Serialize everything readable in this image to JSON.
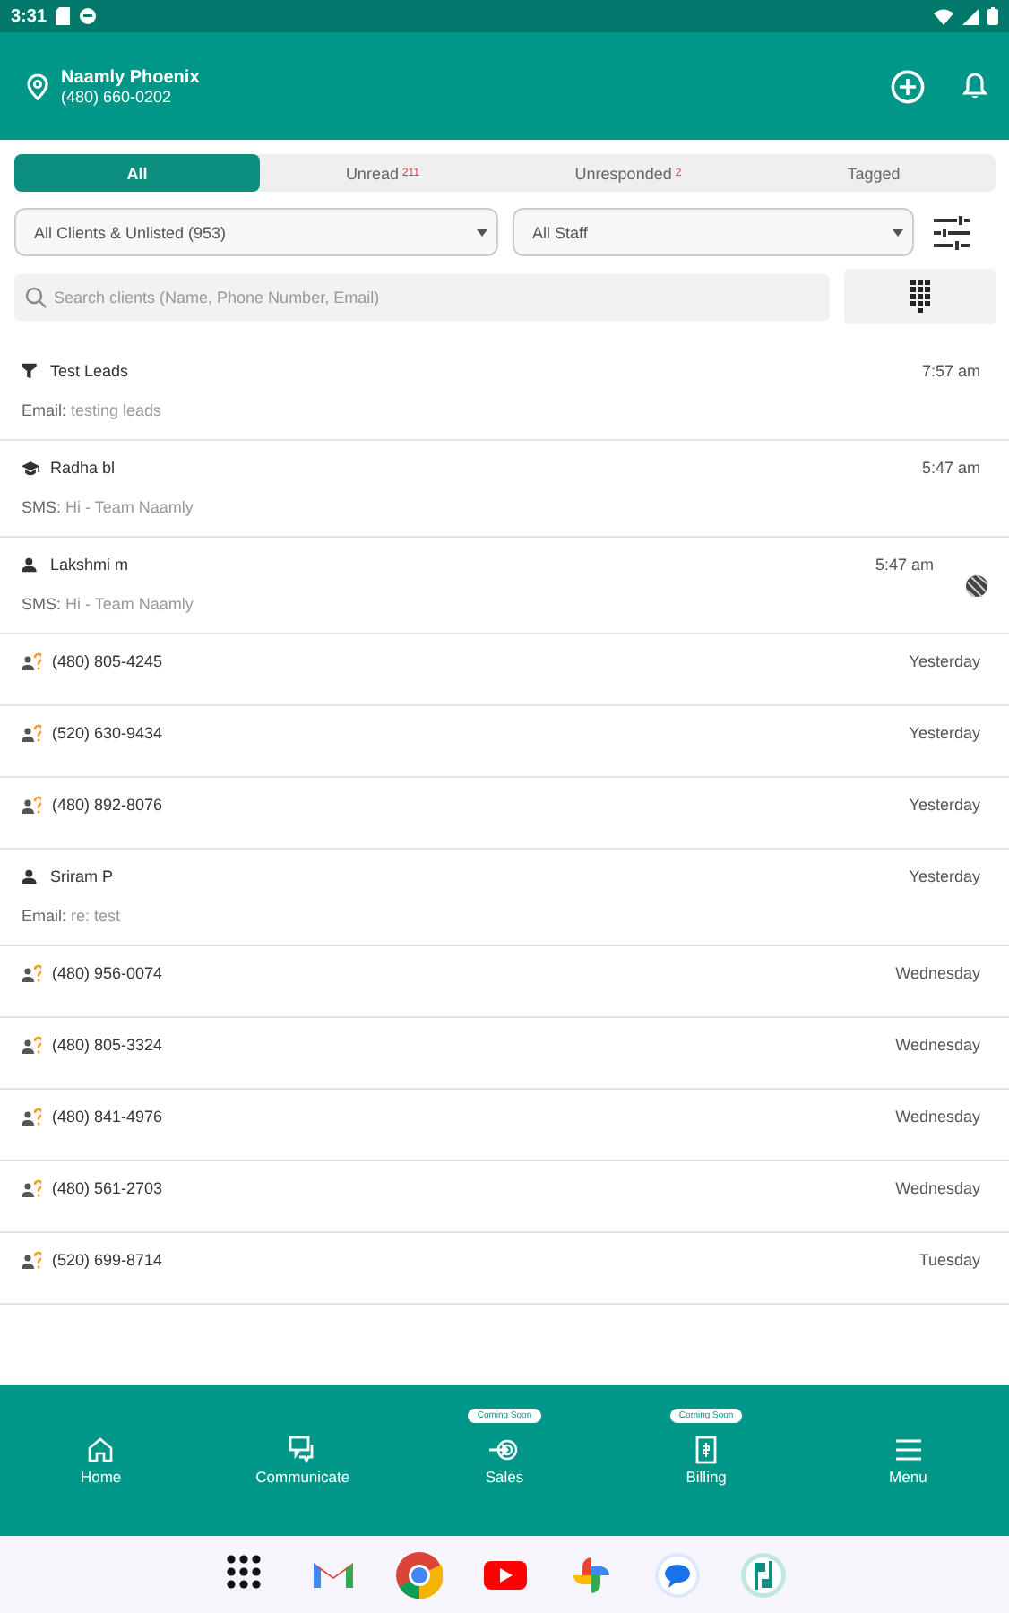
{
  "status_bar": {
    "time": "3:31"
  },
  "header": {
    "location_name": "Naamly Phoenix",
    "phone": "(480) 660-0202"
  },
  "tabs": [
    {
      "label": "All",
      "selected": true
    },
    {
      "label": "Unread",
      "count": "211",
      "selected": false
    },
    {
      "label": "Unresponded",
      "count": "2",
      "selected": false
    },
    {
      "label": "Tagged",
      "selected": false
    }
  ],
  "filters": [
    {
      "value": "All Clients & Unlisted (953)"
    },
    {
      "value": "All Staff"
    }
  ],
  "search": {
    "placeholder": "Search clients (Name, Phone Number, Email)"
  },
  "conversations": [
    {
      "kind": "lead",
      "name": "Test Leads",
      "time": "7:57 am",
      "channel": "Email:",
      "preview": "testing leads"
    },
    {
      "kind": "student",
      "name": "Radha bl",
      "time": "5:47 am",
      "channel": "SMS:",
      "preview": "Hi - Team Naamly"
    },
    {
      "kind": "client",
      "name": "Lakshmi m",
      "time": "5:47 am",
      "channel": "SMS:",
      "preview": "Hi - Team Naamly",
      "floating_icon": true
    },
    {
      "kind": "unknown",
      "name": "(480) 805-4245",
      "time": "Yesterday"
    },
    {
      "kind": "unknown",
      "name": "(520) 630-9434",
      "time": "Yesterday"
    },
    {
      "kind": "unknown",
      "name": "(480) 892-8076",
      "time": "Yesterday"
    },
    {
      "kind": "client",
      "name": "Sriram P",
      "time": "Yesterday",
      "channel": "Email:",
      "preview": "re: test"
    },
    {
      "kind": "unknown",
      "name": "(480) 956-0074",
      "time": "Wednesday"
    },
    {
      "kind": "unknown",
      "name": "(480) 805-3324",
      "time": "Wednesday"
    },
    {
      "kind": "unknown",
      "name": "(480) 841-4976",
      "time": "Wednesday"
    },
    {
      "kind": "unknown",
      "name": "(480) 561-2703",
      "time": "Wednesday"
    },
    {
      "kind": "unknown",
      "name": "(520) 699-8714",
      "time": "Tuesday"
    }
  ],
  "bottom_nav": [
    {
      "kind": "home",
      "label": "Home"
    },
    {
      "kind": "communicate",
      "label": "Communicate"
    },
    {
      "kind": "sales",
      "label": "Sales",
      "badge": "Coming Soon"
    },
    {
      "kind": "billing",
      "label": "Billing",
      "badge": "Coming Soon"
    },
    {
      "kind": "menu",
      "label": "Menu"
    }
  ],
  "dock": [
    {
      "kind": "apps"
    },
    {
      "kind": "gmail"
    },
    {
      "kind": "chrome"
    },
    {
      "kind": "youtube"
    },
    {
      "kind": "photos"
    },
    {
      "kind": "messages"
    },
    {
      "kind": "naamly"
    }
  ]
}
